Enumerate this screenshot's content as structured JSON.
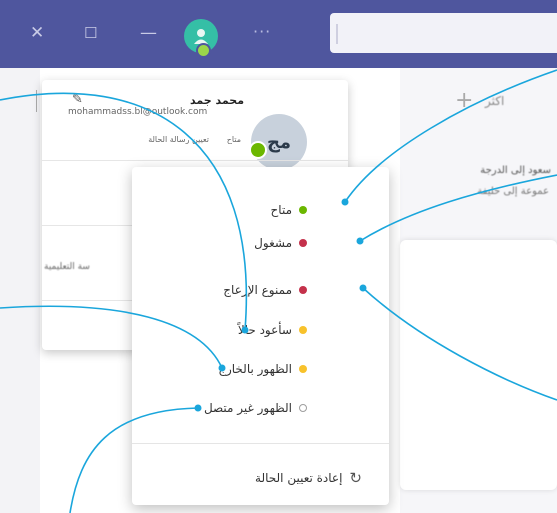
{
  "titlebar": {
    "close_icon": "close-icon",
    "maximize_icon": "maximize-icon",
    "minimize_icon": "minimize-icon",
    "more_icon": "more-icon",
    "bar_color": "#4f569e"
  },
  "background": {
    "more_label": "اكثر",
    "line1": "سعود إلى الدرجة",
    "line2": "عموعة إلى حليفة",
    "edu_label": "سة التعليمية"
  },
  "profile": {
    "initials": "مج",
    "name": "محمد جمد",
    "email": "mohammadss.bl@outlook.com",
    "status_available": "متاح",
    "set_status_message": "تعيين رسالة الحالة"
  },
  "status_menu": {
    "items": [
      {
        "label": "متاح",
        "color": "#6bb700"
      },
      {
        "label": "مشغول",
        "color": "#c4314b"
      },
      {
        "label": "ممنوع الإزعاج",
        "color": "#c4314b"
      },
      {
        "label": "سأعود حالاً",
        "color": "#f8c22b"
      },
      {
        "label": "الظهور بالخارج",
        "color": "#f8c22b"
      },
      {
        "label": "الظهور غير متصل",
        "color": "#9e9e9e"
      }
    ],
    "reset_label": "إعادة تعيين الحالة"
  },
  "colors": {
    "callout": "#1aa6dc",
    "available": "#6bb700",
    "busy": "#c4314b",
    "away": "#f8c22b"
  }
}
